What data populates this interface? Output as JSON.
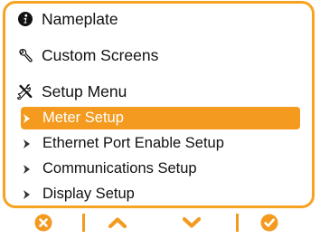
{
  "menu": {
    "items": [
      {
        "label": "Nameplate",
        "icon": "info-icon"
      },
      {
        "label": "Custom Screens",
        "icon": "wrench-icon"
      },
      {
        "label": "Setup Menu",
        "icon": "tools-icon"
      }
    ],
    "submenu": [
      {
        "label": "Meter Setup",
        "selected": true
      },
      {
        "label": "Ethernet Port Enable Setup",
        "selected": false
      },
      {
        "label": "Communications Setup",
        "selected": false
      },
      {
        "label": "Display Setup",
        "selected": false
      }
    ]
  },
  "softkeys": [
    "cancel-icon",
    "up-icon",
    "down-icon",
    "confirm-icon"
  ],
  "colors": {
    "accent": "#f39a1f",
    "frame": "#f7a322",
    "text": "#111111",
    "selected_text": "#ffffff"
  }
}
